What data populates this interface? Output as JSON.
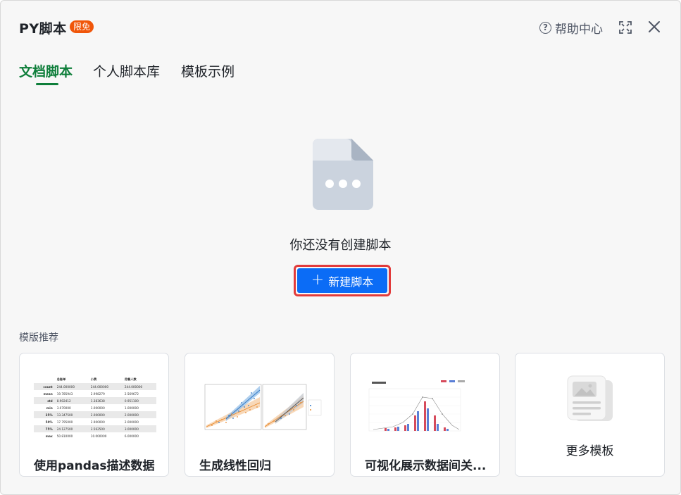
{
  "header": {
    "app_title": "PY脚本",
    "badge": "限免",
    "help_label": "帮助中心"
  },
  "tabs": [
    {
      "label": "文档脚本",
      "active": true
    },
    {
      "label": "个人脚本库",
      "active": false
    },
    {
      "label": "模板示例",
      "active": false
    }
  ],
  "empty_state": {
    "message": "你还没有创建脚本",
    "new_button_label": "新建脚本"
  },
  "templates": {
    "section_label": "模版推荐",
    "cards": [
      {
        "title": "使用pandas描述数据"
      },
      {
        "title": "生成线性回归"
      },
      {
        "title": "可视化展示数据间关..."
      },
      {
        "title": "更多模板"
      }
    ]
  },
  "thumb_table": {
    "headers": [
      "",
      "总账单",
      "小费",
      "用餐人数"
    ],
    "rows": [
      [
        "count",
        "244.000000",
        "244.000000",
        "244.000000"
      ],
      [
        "mean",
        "19.785943",
        "2.998279",
        "2.569672"
      ],
      [
        "std",
        "8.902412",
        "1.383638",
        "0.951100"
      ],
      [
        "min",
        "3.070000",
        "1.000000",
        "1.000000"
      ],
      [
        "25%",
        "13.347500",
        "2.000000",
        "2.000000"
      ],
      [
        "50%",
        "17.795000",
        "2.900000",
        "2.000000"
      ],
      [
        "75%",
        "24.127500",
        "3.562500",
        "3.000000"
      ],
      [
        "max",
        "50.810000",
        "10.000000",
        "6.000000"
      ]
    ]
  },
  "colors": {
    "accent_green": "#0e7e3a",
    "primary_blue": "#0b6cf6",
    "badge_orange": "#f0560a",
    "highlight_red": "#e23b3b"
  }
}
